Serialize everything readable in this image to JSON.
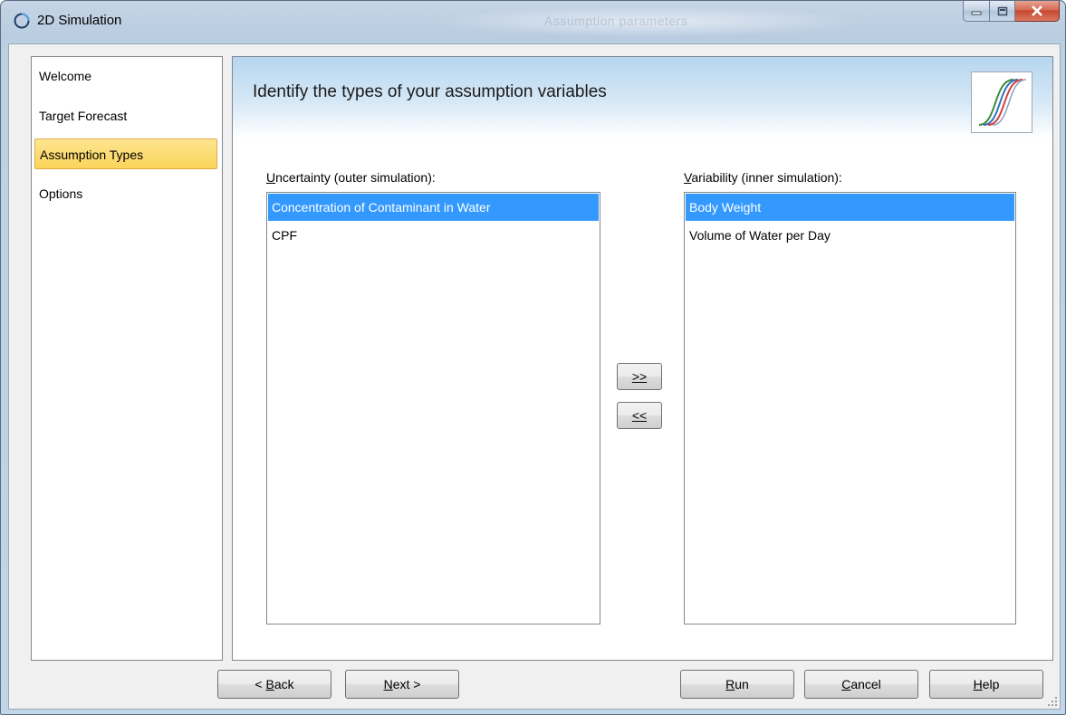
{
  "window": {
    "title": "2D Simulation",
    "ghost_title": "Assumption parameters"
  },
  "nav": {
    "items": [
      {
        "label": "Welcome",
        "selected": false
      },
      {
        "label": "Target Forecast",
        "selected": false
      },
      {
        "label": "Assumption Types",
        "selected": true
      },
      {
        "label": "Options",
        "selected": false
      }
    ]
  },
  "main": {
    "heading": "Identify the types of your assumption variables"
  },
  "uncertainty": {
    "label_first": "U",
    "label_rest": "ncertainty (outer simulation):",
    "items": [
      {
        "label": "Concentration of Contaminant in Water",
        "selected": true
      },
      {
        "label": "CPF",
        "selected": false
      }
    ]
  },
  "variability": {
    "label_first": "V",
    "label_rest": "ariability (inner simulation):",
    "items": [
      {
        "label": "Body Weight",
        "selected": true
      },
      {
        "label": "Volume of Water per Day",
        "selected": false
      }
    ]
  },
  "move": {
    "right_label": ">>",
    "left_label": "<<"
  },
  "buttons": {
    "back": {
      "pre": "< ",
      "key": "B",
      "post": "ack"
    },
    "next": {
      "pre": "",
      "key": "N",
      "post": "ext >"
    },
    "run": {
      "pre": "",
      "key": "R",
      "post": "un"
    },
    "cancel": {
      "pre": "",
      "key": "C",
      "post": "ancel"
    },
    "help": {
      "pre": "",
      "key": "H",
      "post": "elp"
    }
  },
  "colors": {
    "selection": "#3399ff",
    "nav_selected": "#fcd45a",
    "close_button": "#c6462e"
  }
}
